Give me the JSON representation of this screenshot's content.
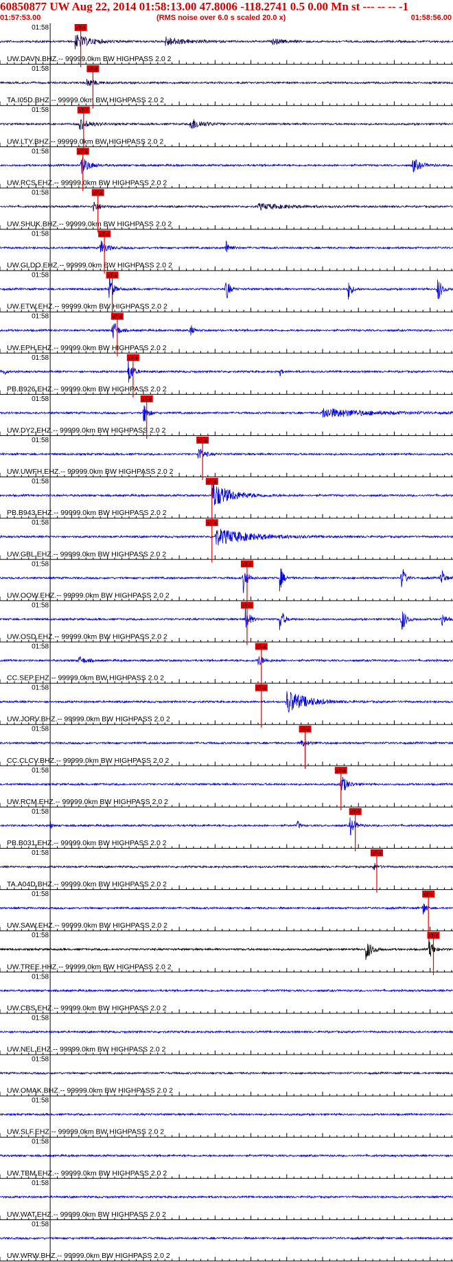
{
  "header": {
    "title": "60850877 UW Aug 22, 2014 01:58:13.00   47.8006 -118.2741  0.5 0.00 Mn st --- -- --  -1",
    "start_time": "01:57:53.00",
    "scale_note": "(RMS noise over 6.0 s scaled 20.0 x)",
    "end_time": "01:58:56.00"
  },
  "colors": {
    "header_text": "#d40000",
    "trace_blue": "#0000e0",
    "trace_dark": "#1a0a5a",
    "trace_black": "#000000",
    "pick": "#e00000",
    "axis": "#000000"
  },
  "chart_data": {
    "type": "line",
    "title": "60850877 UW Aug 22, 2014 01:58:13.00   47.8006 -118.2741  0.5 0.00 Mn st --- -- --  -1",
    "x_range_seconds": [
      0,
      63
    ],
    "x_start": "01:57:53.00",
    "x_end": "01:58:56.00",
    "minute_label": "01:58",
    "pick_label": "xT-4",
    "series": [
      {
        "name": "UW.DAVN.BHZ.--",
        "label": "UW.DAVN.BHZ.-- 99999.0km BW  HIGHPASS  2.0  2",
        "color": "dark",
        "pick_s": 10.4,
        "bursts": [
          {
            "t": 10.4,
            "a": 0.8,
            "d": 4
          },
          {
            "t": 23,
            "a": 0.5,
            "d": 5
          },
          {
            "t": 38,
            "a": 0.3,
            "d": 3
          }
        ]
      },
      {
        "name": "TA.I05D.BHZ.--",
        "label": "TA.I05D.BHZ.-- 99999.0km BW  HIGHPASS  2.0  2",
        "color": "dark",
        "pick_s": 12.1,
        "bursts": [
          {
            "t": 12.1,
            "a": 0.5,
            "d": 2
          }
        ]
      },
      {
        "name": "UW.LTY.BHZ.--",
        "label": "UW.LTY.BHZ.-- 99999.0km BW  HIGHPASS  2.0  2",
        "color": "dark",
        "pick_s": 10.8,
        "bursts": [
          {
            "t": 11,
            "a": 0.6,
            "d": 3
          },
          {
            "t": 26.5,
            "a": 0.7,
            "d": 3
          }
        ]
      },
      {
        "name": "UW.RCS.EHZ.--",
        "label": "UW.RCS.EHZ.-- 99999.0km BW  HIGHPASS  2.0  2",
        "color": "blue",
        "pick_s": 10.7,
        "bursts": [
          {
            "t": 11.3,
            "a": 1.0,
            "d": 2
          },
          {
            "t": 57.5,
            "a": 0.8,
            "d": 2
          }
        ]
      },
      {
        "name": "UW.SHUK.BHZ.--",
        "label": "UW.SHUK.BHZ.-- 99999.0km BW  HIGHPASS  2.0  2",
        "color": "dark",
        "pick_s": 12.8,
        "bursts": [
          {
            "t": 13,
            "a": 0.7,
            "d": 1.5
          },
          {
            "t": 36,
            "a": 0.3,
            "d": 8
          }
        ]
      },
      {
        "name": "UW.GLDO.EHZ.--",
        "label": "UW.GLDO.EHZ.-- 99999.0km BW  HIGHPASS  2.0  2",
        "color": "blue",
        "pick_s": 13.7,
        "bursts": [
          {
            "t": 14,
            "a": 1.0,
            "d": 1.5
          },
          {
            "t": 31.5,
            "a": 0.8,
            "d": 1
          }
        ]
      },
      {
        "name": "UW.ETW.EHZ.--",
        "label": "UW.ETW.EHZ.-- 99999.0km BW  HIGHPASS  2.0  2",
        "color": "blue",
        "pick_s": 14.8,
        "bursts": [
          {
            "t": 15.2,
            "a": 1.6,
            "d": 1
          },
          {
            "t": 31.5,
            "a": 1.6,
            "d": 0.8
          },
          {
            "t": 48.5,
            "a": 1.4,
            "d": 0.8
          },
          {
            "t": 61,
            "a": 1.6,
            "d": 1
          }
        ]
      },
      {
        "name": "UW.EPH.EHZ.--",
        "label": "UW.EPH.EHZ.-- 99999.0km BW  HIGHPASS  2.0  2",
        "color": "blue",
        "pick_s": 15.5,
        "bursts": [
          {
            "t": 15.7,
            "a": 1.2,
            "d": 1.2
          },
          {
            "t": 26.5,
            "a": 0.9,
            "d": 0.6
          }
        ]
      },
      {
        "name": "PB.B926.EHZ.--",
        "label": "PB.B926.EHZ.-- 99999.0km BW  HIGHPASS  2.0  2",
        "color": "blue",
        "pick_s": 17.7,
        "bursts": [
          {
            "t": 0.5,
            "a": 0.6,
            "d": 0.5
          },
          {
            "t": 17.9,
            "a": 1.6,
            "d": 1
          },
          {
            "t": 39,
            "a": 0.5,
            "d": 0.5
          }
        ]
      },
      {
        "name": "UW.DY2.EHZ.--",
        "label": "UW.DY2.EHZ.-- 99999.0km BW  HIGHPASS  2.0  2",
        "color": "blue",
        "pick_s": 19.6,
        "bursts": [
          {
            "t": 20,
            "a": 1.3,
            "d": 1
          },
          {
            "t": 45,
            "a": 0.5,
            "d": 12
          }
        ]
      },
      {
        "name": "UW.UWFH.EHZ.--",
        "label": "UW.UWFH.EHZ.-- 99999.0km BW  HIGHPASS  2.0  2",
        "color": "blue",
        "pick_s": 27.4,
        "bursts": [
          {
            "t": 27.6,
            "a": 0.8,
            "d": 1.5
          }
        ]
      },
      {
        "name": "PB.B943.EHZ.--",
        "label": "PB.B943.EHZ.-- 99999.0km BW  HIGHPASS  2.0  2",
        "color": "blue",
        "pick_s": 28.7,
        "bursts": [
          {
            "t": 29.5,
            "a": 1.4,
            "d": 5
          }
        ]
      },
      {
        "name": "UW.GBL.EHZ.--",
        "label": "UW.GBL.EHZ.-- 99999.0km BW  HIGHPASS  2.0  2",
        "color": "blue",
        "pick_s": 28.7,
        "bursts": [
          {
            "t": 30,
            "a": 0.9,
            "d": 9
          }
        ]
      },
      {
        "name": "UW.OOW.EHZ.--",
        "label": "UW.OOW.EHZ.-- 99999.0km BW  HIGHPASS  2.0  2",
        "color": "blue",
        "pick_s": 33.6,
        "bursts": [
          {
            "t": 33.9,
            "a": 1.6,
            "d": 1
          },
          {
            "t": 39,
            "a": 1.6,
            "d": 0.8
          },
          {
            "t": 56,
            "a": 1.6,
            "d": 0.8
          },
          {
            "t": 61.5,
            "a": 1.3,
            "d": 0.8
          }
        ]
      },
      {
        "name": "UW.OSD.EHZ.--",
        "label": "UW.OSD.EHZ.-- 99999.0km BW  HIGHPASS  2.0  2",
        "color": "blue",
        "pick_s": 33.6,
        "bursts": [
          {
            "t": 34.2,
            "a": 1.6,
            "d": 1
          },
          {
            "t": 39,
            "a": 1.4,
            "d": 1
          },
          {
            "t": 56,
            "a": 1.6,
            "d": 1
          },
          {
            "t": 61.5,
            "a": 0.9,
            "d": 1
          }
        ]
      },
      {
        "name": "CC.SEP.EHZ.--",
        "label": "CC.SEP.EHZ.-- 99999.0km BW  HIGHPASS  2.0  2",
        "color": "blue",
        "pick_s": 35.6,
        "bursts": [
          {
            "t": 11,
            "a": 0.4,
            "d": 2
          },
          {
            "t": 36,
            "a": 0.6,
            "d": 1.5
          }
        ]
      },
      {
        "name": "UW.JORV.BHZ.--",
        "label": "UW.JORV.BHZ.-- 99999.0km BW  HIGHPASS  2.0  2",
        "color": "blue",
        "pick_s": 35.6,
        "bursts": [
          {
            "t": 40,
            "a": 1.3,
            "d": 5
          }
        ]
      },
      {
        "name": "CC.CLCV.BHZ.--",
        "label": "CC.CLCV.BHZ.-- 99999.0km BW  HIGHPASS  2.0  2",
        "color": "blue",
        "pick_s": 41.7,
        "bursts": [
          {
            "t": 42,
            "a": 0.4,
            "d": 2
          }
        ]
      },
      {
        "name": "UW.RCM.EHZ.--",
        "label": "UW.RCM.EHZ.-- 99999.0km BW  HIGHPASS  2.0  2",
        "color": "blue",
        "pick_s": 46.7,
        "bursts": [
          {
            "t": 47.5,
            "a": 1.2,
            "d": 1.5
          }
        ]
      },
      {
        "name": "PB.B031.EHZ.--",
        "label": "PB.B031.EHZ.-- 99999.0km BW  HIGHPASS  2.0  2",
        "color": "blue",
        "pick_s": 48.7,
        "bursts": [
          {
            "t": 7,
            "a": 0.5,
            "d": 0.4
          },
          {
            "t": 41.5,
            "a": 0.6,
            "d": 0.5
          },
          {
            "t": 48.8,
            "a": 1.1,
            "d": 1.2
          }
        ]
      },
      {
        "name": "TA.A04D.BHZ.--",
        "label": "TA.A04D.BHZ.-- 99999.0km BW  HIGHPASS  2.0  2",
        "color": "dark",
        "pick_s": 51.7,
        "bursts": [
          {
            "t": 52,
            "a": 0.6,
            "d": 1
          }
        ]
      },
      {
        "name": "UW.SAW.EHZ.--",
        "label": "UW.SAW.EHZ.-- 99999.0km BW  HIGHPASS  2.0  2",
        "color": "blue",
        "pick_s": 58.9,
        "bursts": [
          {
            "t": 59,
            "a": 1.1,
            "d": 0.6
          }
        ]
      },
      {
        "name": "UW.TREE.HHZ.--",
        "label": "UW.TREE.HHZ.-- 99999.0km BW  HIGHPASS  2.0  2",
        "color": "black",
        "pick_s": 59.6,
        "bursts": [
          {
            "t": 51,
            "a": 1.2,
            "d": 1.5
          },
          {
            "t": 59.8,
            "a": 1.3,
            "d": 1
          }
        ]
      },
      {
        "name": "UW.CBS.EHZ.--",
        "label": "UW.CBS.EHZ.-- 99999.0km BW  HIGHPASS  2.0  2",
        "color": "blue",
        "pick_s": null,
        "bursts": []
      },
      {
        "name": "UW.NEL.EHZ.--",
        "label": "UW.NEL.EHZ.-- 99999.0km BW  HIGHPASS  2.0  2",
        "color": "blue",
        "pick_s": null,
        "bursts": []
      },
      {
        "name": "UW.OMAK.BHZ.--",
        "label": "UW.OMAK.BHZ.-- 99999.0km BW  HIGHPASS  2.0  2",
        "color": "dark",
        "pick_s": null,
        "bursts": []
      },
      {
        "name": "UW.SLF.EHZ.--",
        "label": "UW.SLF.EHZ.-- 99999.0km BW  HIGHPASS  2.0  2",
        "color": "blue",
        "pick_s": null,
        "bursts": []
      },
      {
        "name": "UW.TBM.EHZ.--",
        "label": "UW.TBM.EHZ.-- 99999.0km BW  HIGHPASS  2.0  2",
        "color": "blue",
        "pick_s": null,
        "bursts": []
      },
      {
        "name": "UW.WAT.EHZ.--",
        "label": "UW.WAT.EHZ.-- 99999.0km BW  HIGHPASS  2.0  2",
        "color": "blue",
        "pick_s": null,
        "bursts": []
      },
      {
        "name": "UW.WRW.BHZ.--",
        "label": "UW.WRW.BHZ.-- 99999.0km BW  HIGHPASS  2.0  2",
        "color": "blue",
        "pick_s": null,
        "bursts": []
      }
    ]
  }
}
